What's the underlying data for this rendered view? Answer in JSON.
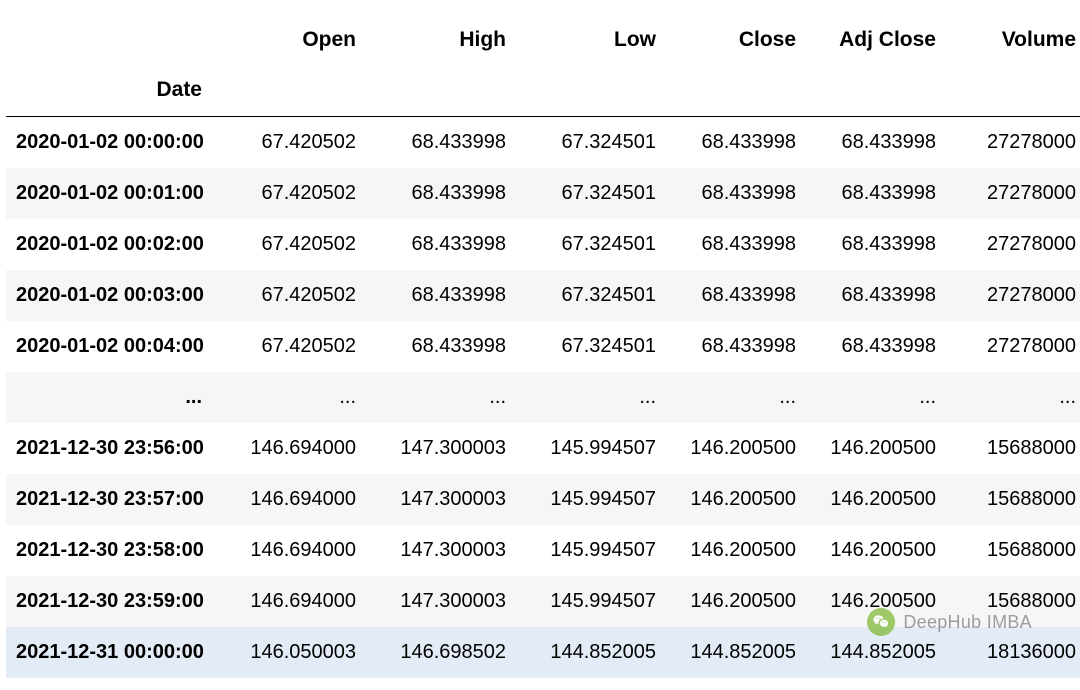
{
  "chart_data": {
    "type": "table",
    "title": "",
    "index_label": "Date",
    "columns": [
      "Open",
      "High",
      "Low",
      "Close",
      "Adj Close",
      "Volume"
    ],
    "rows": [
      {
        "date": "2020-01-02 00:00:00",
        "open": "67.420502",
        "high": "68.433998",
        "low": "67.324501",
        "close": "68.433998",
        "adj_close": "68.433998",
        "volume": "27278000"
      },
      {
        "date": "2020-01-02 00:01:00",
        "open": "67.420502",
        "high": "68.433998",
        "low": "67.324501",
        "close": "68.433998",
        "adj_close": "68.433998",
        "volume": "27278000"
      },
      {
        "date": "2020-01-02 00:02:00",
        "open": "67.420502",
        "high": "68.433998",
        "low": "67.324501",
        "close": "68.433998",
        "adj_close": "68.433998",
        "volume": "27278000"
      },
      {
        "date": "2020-01-02 00:03:00",
        "open": "67.420502",
        "high": "68.433998",
        "low": "67.324501",
        "close": "68.433998",
        "adj_close": "68.433998",
        "volume": "27278000"
      },
      {
        "date": "2020-01-02 00:04:00",
        "open": "67.420502",
        "high": "68.433998",
        "low": "67.324501",
        "close": "68.433998",
        "adj_close": "68.433998",
        "volume": "27278000"
      },
      {
        "date": "...",
        "open": "...",
        "high": "...",
        "low": "...",
        "close": "...",
        "adj_close": "...",
        "volume": "..."
      },
      {
        "date": "2021-12-30 23:56:00",
        "open": "146.694000",
        "high": "147.300003",
        "low": "145.994507",
        "close": "146.200500",
        "adj_close": "146.200500",
        "volume": "15688000"
      },
      {
        "date": "2021-12-30 23:57:00",
        "open": "146.694000",
        "high": "147.300003",
        "low": "145.994507",
        "close": "146.200500",
        "adj_close": "146.200500",
        "volume": "15688000"
      },
      {
        "date": "2021-12-30 23:58:00",
        "open": "146.694000",
        "high": "147.300003",
        "low": "145.994507",
        "close": "146.200500",
        "adj_close": "146.200500",
        "volume": "15688000"
      },
      {
        "date": "2021-12-30 23:59:00",
        "open": "146.694000",
        "high": "147.300003",
        "low": "145.994507",
        "close": "146.200500",
        "adj_close": "146.200500",
        "volume": "15688000"
      },
      {
        "date": "2021-12-31 00:00:00",
        "open": "146.050003",
        "high": "146.698502",
        "low": "144.852005",
        "close": "144.852005",
        "adj_close": "144.852005",
        "volume": "18136000"
      }
    ]
  },
  "watermark": {
    "text": "DeepHub IMBA"
  }
}
